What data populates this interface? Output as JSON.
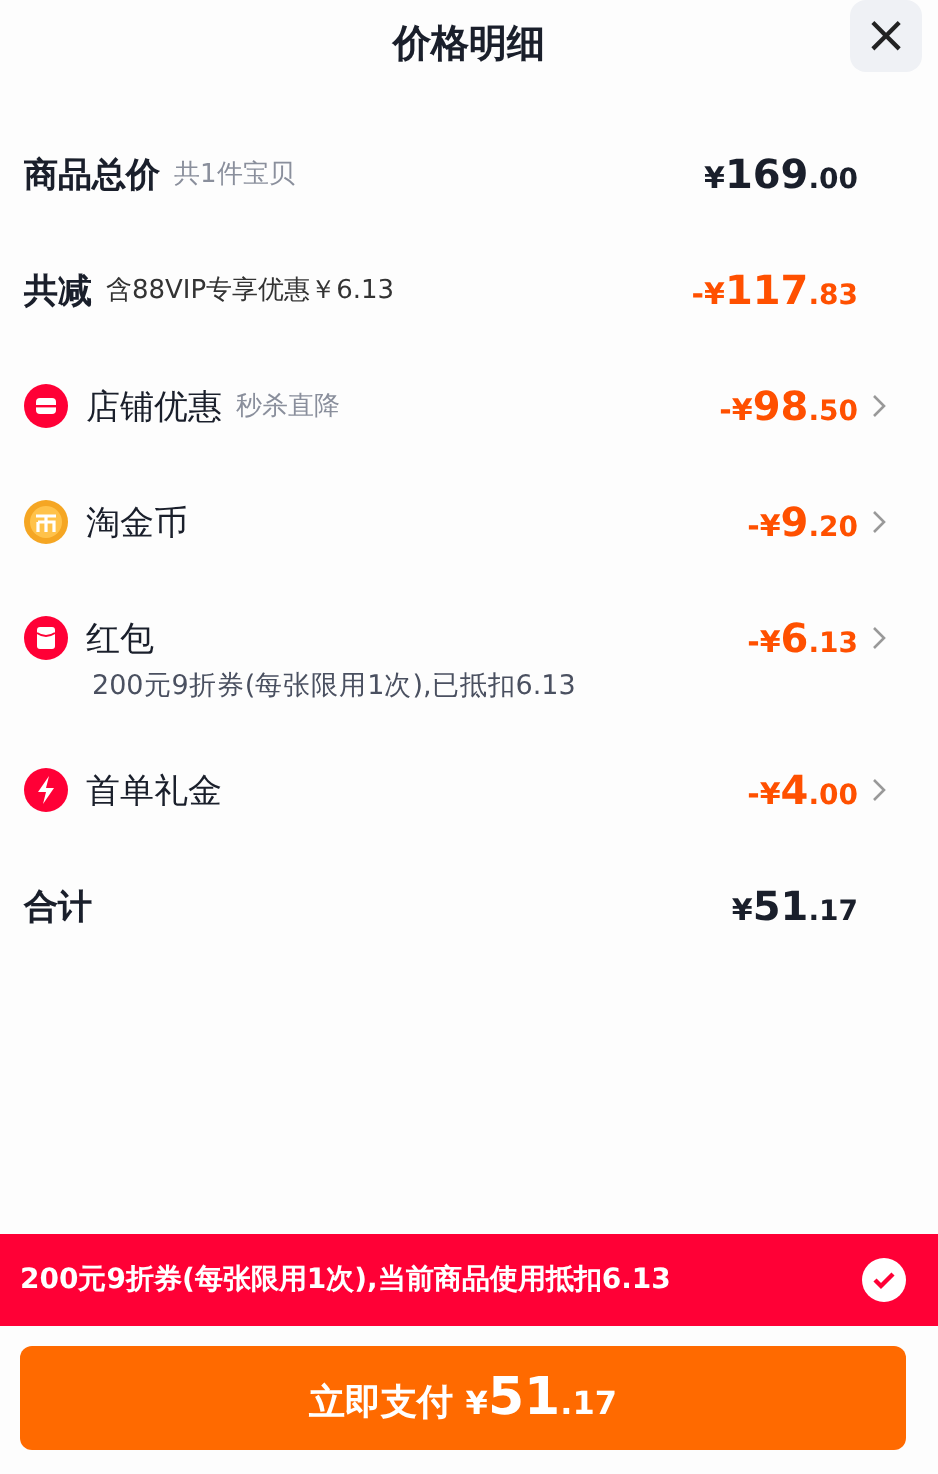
{
  "header": {
    "title": "价格明细",
    "close": "×"
  },
  "rows": [
    {
      "kind": "total",
      "label": "商品总价",
      "note": "共1件宝贝",
      "amount": {
        "sign": "¥",
        "main": "169",
        "cents": ".00"
      },
      "accent": false,
      "chevron": false
    },
    {
      "kind": "total",
      "label": "共减",
      "note": "含88VIP专享优惠￥6.13",
      "amount": {
        "sign": "-¥",
        "main": "117",
        "cents": ".83"
      },
      "accent": true,
      "chevron": false
    },
    {
      "kind": "shop",
      "label": "店铺优惠",
      "note": "秒杀直降",
      "amount": {
        "sign": "-¥",
        "main": "98",
        "cents": ".50"
      },
      "accent": true,
      "chevron": true
    },
    {
      "kind": "coin",
      "label": "淘金币",
      "amount": {
        "sign": "-¥",
        "main": "9",
        "cents": ".20"
      },
      "accent": true,
      "chevron": true
    },
    {
      "kind": "packet",
      "label": "红包",
      "detail": "200元9折券(每张限用1次),已抵扣6.13",
      "amount": {
        "sign": "-¥",
        "main": "6",
        "cents": ".13"
      },
      "accent": true,
      "chevron": true
    },
    {
      "kind": "bolt",
      "label": "首单礼金",
      "amount": {
        "sign": "-¥",
        "main": "4",
        "cents": ".00"
      },
      "accent": true,
      "chevron": true
    },
    {
      "kind": "total",
      "label": "合计",
      "amount": {
        "sign": "¥",
        "main": "51",
        "cents": ".17"
      },
      "accent": false,
      "chevron": false
    }
  ],
  "banner": {
    "text": "200元9折券(每张限用1次),当前商品使用抵扣6.13",
    "checked": true
  },
  "pay_button": {
    "label": "立即支付",
    "sign": "¥",
    "main": "51",
    "cents": ".17"
  }
}
